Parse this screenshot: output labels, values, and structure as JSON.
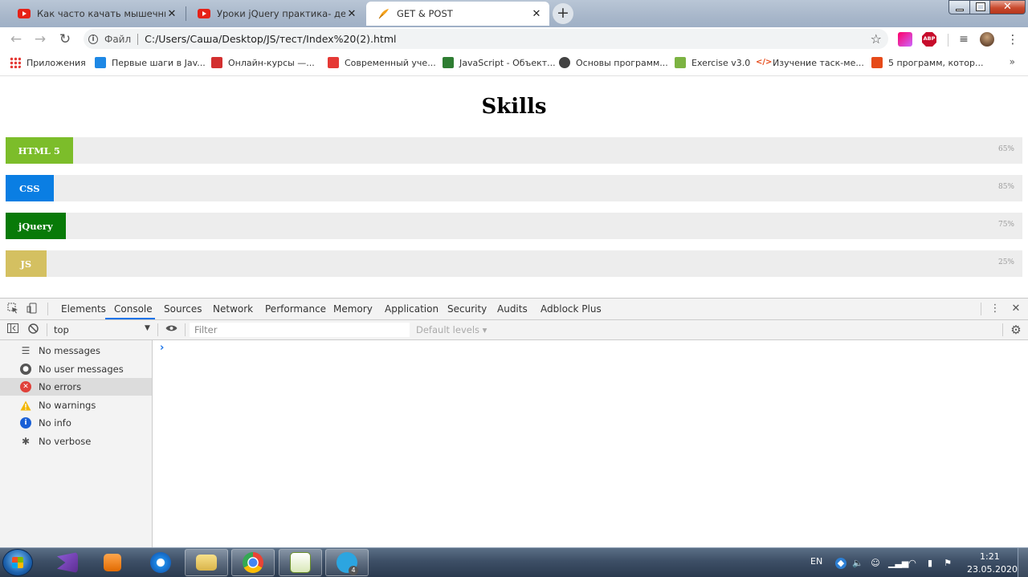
{
  "browser": {
    "tabs": [
      {
        "title": "Как часто качать мышечные группы",
        "active": false
      },
      {
        "title": "Уроки jQuery практика- делаем",
        "active": false
      },
      {
        "title": "GET & POST",
        "active": true
      }
    ],
    "new_tab_label": "+",
    "close_glyph": "✕",
    "omnibox": {
      "scheme_label": "Файл",
      "url": "C:/Users/Саша/Desktop/JS/тест/Index%20(2).html"
    },
    "extensions": {
      "abp_label": "ABP"
    },
    "bookmarks": [
      {
        "label": "Приложения",
        "color": "#e53935"
      },
      {
        "label": "Первые шаги в Jav...",
        "color": "#1e88e5"
      },
      {
        "label": "Онлайн-курсы —...",
        "color": "#d32f2f"
      },
      {
        "label": "Современный уче...",
        "color": "#e53935"
      },
      {
        "label": "JavaScript - Объект...",
        "color": "#2e7d32"
      },
      {
        "label": "Основы программ...",
        "color": "#424242"
      },
      {
        "label": "Exercise v3.0",
        "color": "#7cb342"
      },
      {
        "label": "Изучение таск-ме...",
        "color": "#e64a19"
      },
      {
        "label": "5 программ, котор...",
        "color": "#e64a19"
      }
    ],
    "bookmarks_more": "»"
  },
  "page": {
    "title": "Skills",
    "skills": [
      {
        "name": "HTML 5",
        "percent": "65%",
        "fill_fraction": 0.066,
        "color": "#7cbd2a"
      },
      {
        "name": "CSS",
        "percent": "85%",
        "fill_fraction": 0.047,
        "color": "#0a7ee3"
      },
      {
        "name": "jQuery",
        "percent": "75%",
        "fill_fraction": 0.059,
        "color": "#087a08"
      },
      {
        "name": "JS",
        "percent": "25%",
        "fill_fraction": 0.04,
        "color": "#d4c061"
      }
    ]
  },
  "devtools": {
    "tabs": [
      "Elements",
      "Console",
      "Sources",
      "Network",
      "Performance",
      "Memory",
      "Application",
      "Security",
      "Audits",
      "Adblock Plus"
    ],
    "active_tab": "Console",
    "context": "top",
    "filter_placeholder": "Filter",
    "levels_label": "Default levels ▾",
    "sidebar": [
      {
        "label": "No messages",
        "icon": "list-icon",
        "color": "#555555",
        "selected": false
      },
      {
        "label": "No user messages",
        "icon": "user-icon",
        "color": "#555555",
        "selected": false
      },
      {
        "label": "No errors",
        "icon": "error-icon",
        "color": "#e0413a",
        "selected": true
      },
      {
        "label": "No warnings",
        "icon": "warning-icon",
        "color": "#f2b600",
        "selected": false
      },
      {
        "label": "No info",
        "icon": "info-icon",
        "color": "#1a60d6",
        "selected": false
      },
      {
        "label": "No verbose",
        "icon": "bug-icon",
        "color": "#555555",
        "selected": false
      }
    ],
    "prompt_glyph": "›"
  },
  "taskbar": {
    "lang": "EN",
    "time": "1:21",
    "date": "23.05.2020",
    "telegram_badge": "4"
  }
}
